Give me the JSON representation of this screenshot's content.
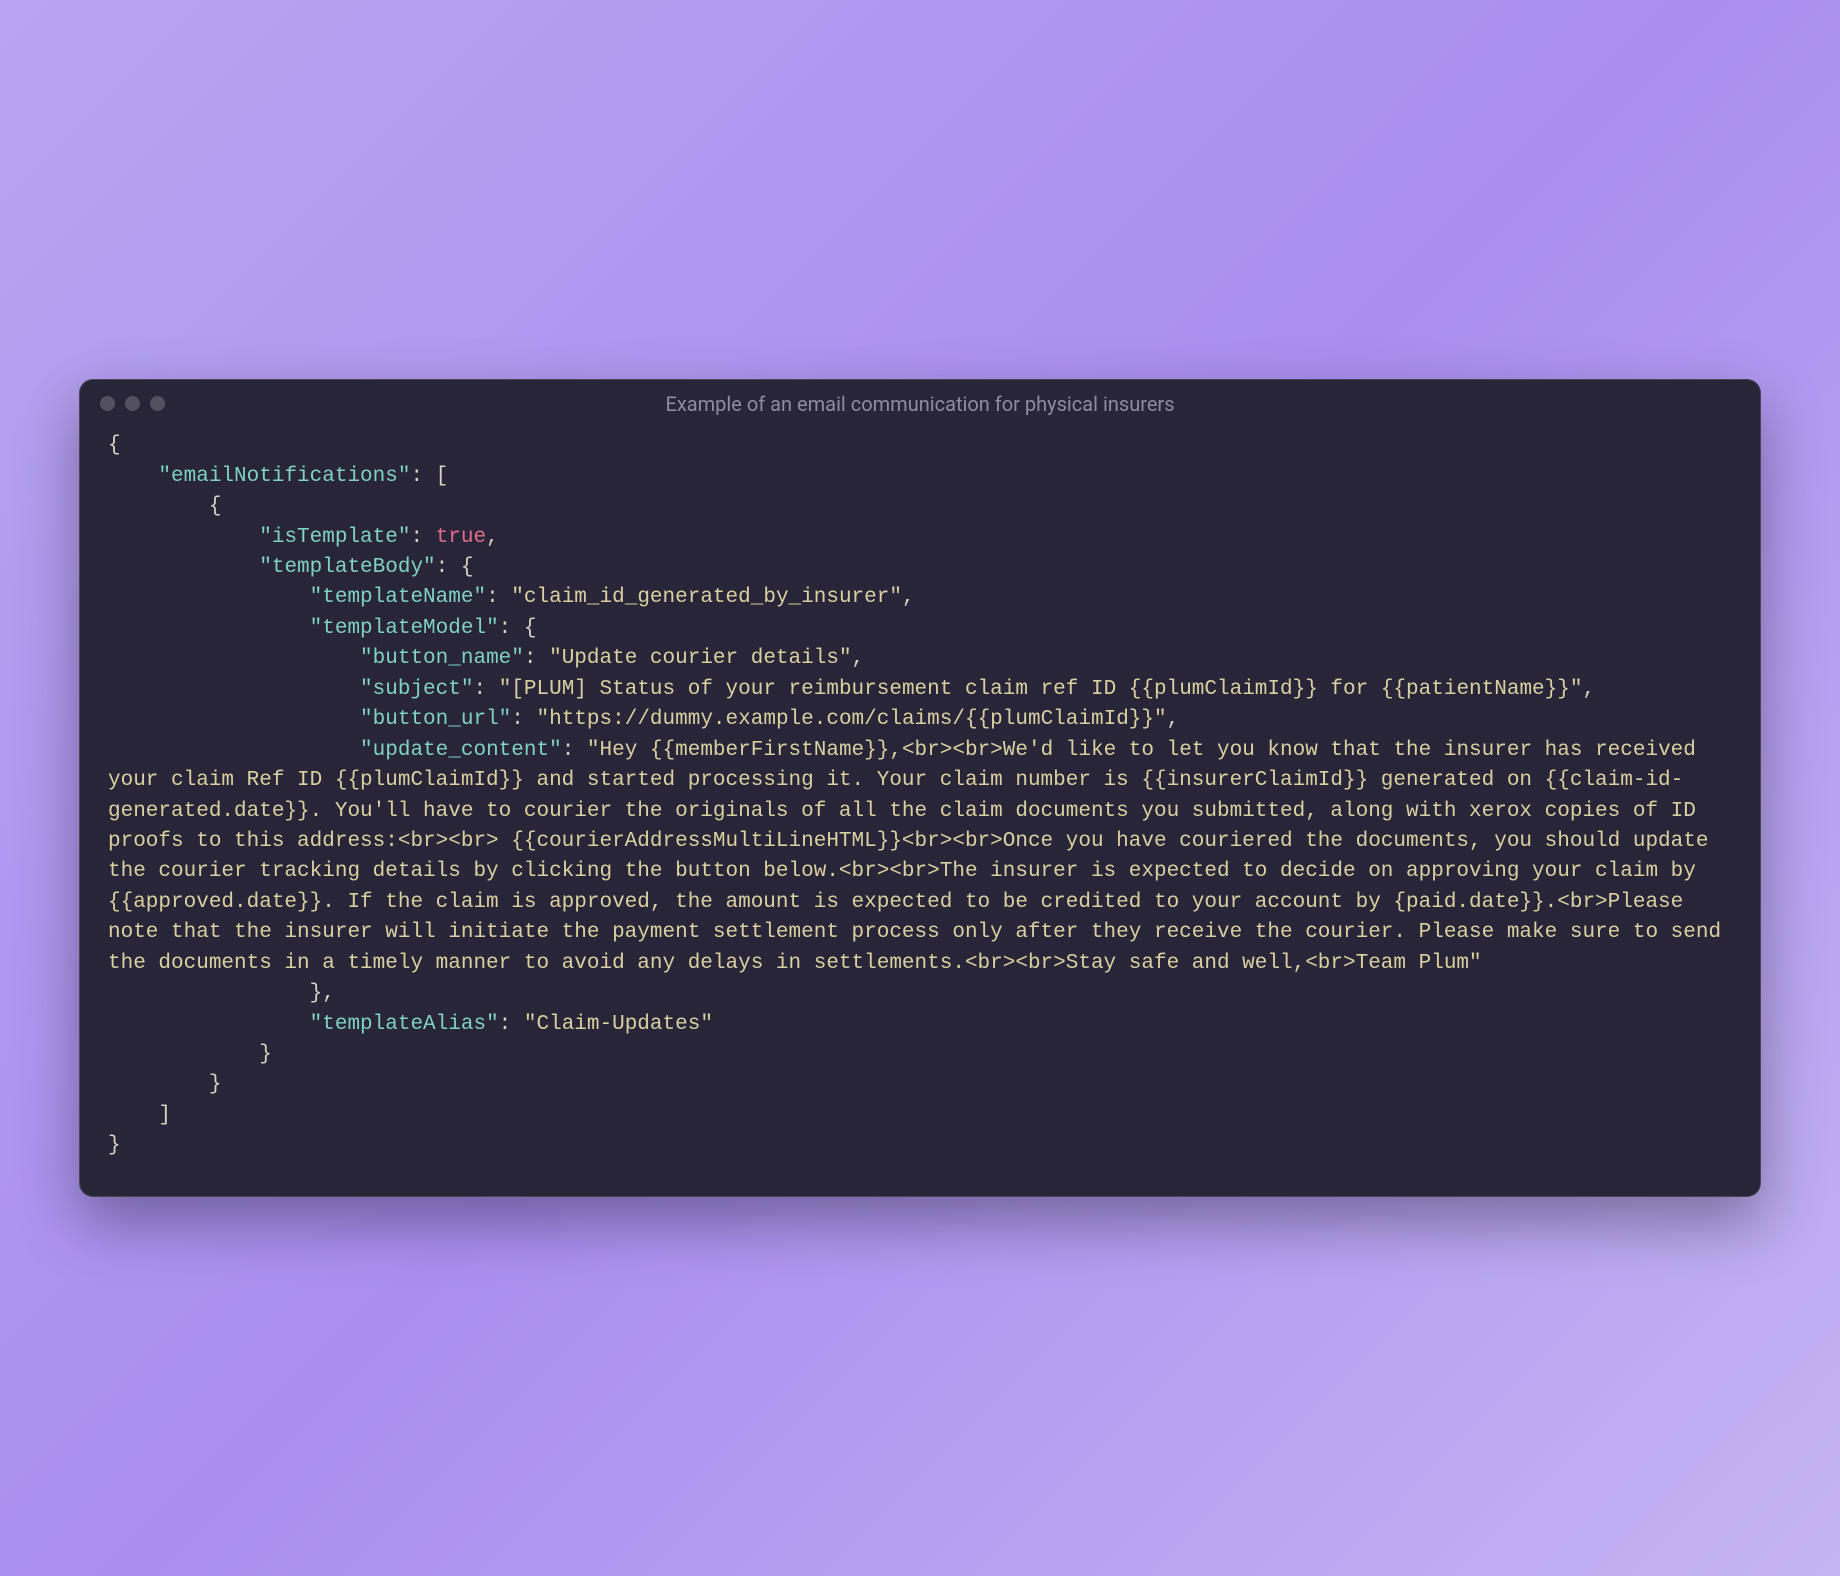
{
  "window": {
    "title": "Example of an email communication for physical insurers"
  },
  "code": {
    "lines": [
      {
        "indent": 0,
        "tokens": [
          {
            "t": "punc",
            "v": "{"
          }
        ]
      },
      {
        "indent": 1,
        "tokens": [
          {
            "t": "key",
            "v": "\"emailNotifications\""
          },
          {
            "t": "punc",
            "v": ": ["
          }
        ]
      },
      {
        "indent": 2,
        "tokens": [
          {
            "t": "punc",
            "v": "{"
          }
        ]
      },
      {
        "indent": 3,
        "tokens": [
          {
            "t": "key",
            "v": "\"isTemplate\""
          },
          {
            "t": "punc",
            "v": ": "
          },
          {
            "t": "bool",
            "v": "true"
          },
          {
            "t": "punc",
            "v": ","
          }
        ]
      },
      {
        "indent": 3,
        "tokens": [
          {
            "t": "key",
            "v": "\"templateBody\""
          },
          {
            "t": "punc",
            "v": ": {"
          }
        ]
      },
      {
        "indent": 4,
        "tokens": [
          {
            "t": "key",
            "v": "\"templateName\""
          },
          {
            "t": "punc",
            "v": ": "
          },
          {
            "t": "str",
            "v": "\"claim_id_generated_by_insurer\""
          },
          {
            "t": "punc",
            "v": ","
          }
        ]
      },
      {
        "indent": 4,
        "tokens": [
          {
            "t": "key",
            "v": "\"templateModel\""
          },
          {
            "t": "punc",
            "v": ": {"
          }
        ]
      },
      {
        "indent": 5,
        "tokens": [
          {
            "t": "key",
            "v": "\"button_name\""
          },
          {
            "t": "punc",
            "v": ": "
          },
          {
            "t": "str",
            "v": "\"Update courier details\""
          },
          {
            "t": "punc",
            "v": ","
          }
        ]
      },
      {
        "indent": 5,
        "tokens": [
          {
            "t": "key",
            "v": "\"subject\""
          },
          {
            "t": "punc",
            "v": ": "
          },
          {
            "t": "str",
            "v": "\"[PLUM] Status of your reimbursement claim ref ID {{plumClaimId}} for {{patientName}}\""
          },
          {
            "t": "punc",
            "v": ","
          }
        ]
      },
      {
        "indent": 5,
        "tokens": [
          {
            "t": "key",
            "v": "\"button_url\""
          },
          {
            "t": "punc",
            "v": ": "
          },
          {
            "t": "str",
            "v": "\"https://dummy.example.com/claims/{{plumClaimId}}\""
          },
          {
            "t": "punc",
            "v": ","
          }
        ]
      },
      {
        "indent": 5,
        "tokens": [
          {
            "t": "key",
            "v": "\"update_content\""
          },
          {
            "t": "punc",
            "v": ": "
          },
          {
            "t": "str",
            "v": "\"Hey {{memberFirstName}},<br><br>We'd like to let you know that the insurer has received your claim Ref ID {{plumClaimId}} and started processing it. Your claim number is {{insurerClaimId}} generated on {{claim-id-generated.date}}. You'll have to courier the originals of all the claim documents you submitted, along with xerox copies of ID proofs to this address:<br><br> {{courierAddressMultiLineHTML}}<br><br>Once you have couriered the documents, you should update the courier tracking details by clicking the button below.<br><br>The insurer is expected to decide on approving your claim by {{approved.date}}. If the claim is approved, the amount is expected to be credited to your account by {paid.date}}.<br>Please note that the insurer will initiate the payment settlement process only after they receive the courier. Please make sure to send the documents in a timely manner to avoid any delays in settlements.<br><br>Stay safe and well,<br>Team Plum\""
          }
        ]
      },
      {
        "indent": 4,
        "tokens": [
          {
            "t": "punc",
            "v": "},"
          }
        ]
      },
      {
        "indent": 4,
        "tokens": [
          {
            "t": "key",
            "v": "\"templateAlias\""
          },
          {
            "t": "punc",
            "v": ": "
          },
          {
            "t": "str",
            "v": "\"Claim-Updates\""
          }
        ]
      },
      {
        "indent": 3,
        "tokens": [
          {
            "t": "punc",
            "v": "}"
          }
        ]
      },
      {
        "indent": 2,
        "tokens": [
          {
            "t": "punc",
            "v": "}"
          }
        ]
      },
      {
        "indent": 1,
        "tokens": [
          {
            "t": "punc",
            "v": "]"
          }
        ]
      },
      {
        "indent": 0,
        "tokens": [
          {
            "t": "punc",
            "v": "}"
          }
        ]
      }
    ],
    "indentUnit": "    "
  }
}
